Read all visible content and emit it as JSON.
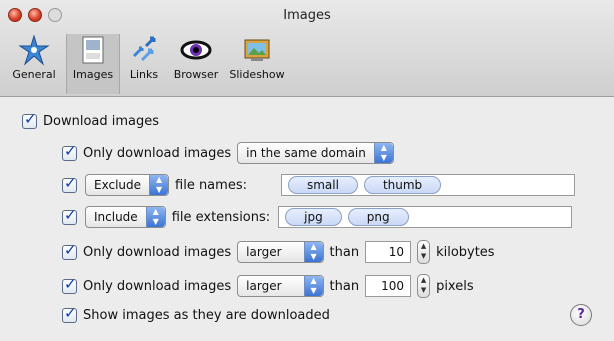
{
  "window": {
    "title": "Images"
  },
  "toolbar": {
    "items": [
      {
        "label": "General",
        "icon": "star-gear-icon"
      },
      {
        "label": "Images",
        "icon": "jpeg-file-icon"
      },
      {
        "label": "Links",
        "icon": "links-arrows-icon"
      },
      {
        "label": "Browser",
        "icon": "eye-icon"
      },
      {
        "label": "Slideshow",
        "icon": "picture-frame-icon"
      }
    ],
    "selected": "Images"
  },
  "settings": {
    "download_images": {
      "checked": true,
      "label": "Download images"
    },
    "only_domain": {
      "checked": true,
      "label": "Only download images",
      "popup": "in the same domain"
    },
    "filenames": {
      "checked": true,
      "popup": "Exclude",
      "label": "file names:",
      "tokens": [
        "small",
        "thumb"
      ]
    },
    "extensions": {
      "checked": true,
      "popup": "Include",
      "label": "file extensions:",
      "tokens": [
        "jpg",
        "png"
      ]
    },
    "size_kb": {
      "checked": true,
      "label": "Only download images",
      "popup": "larger",
      "than": "than",
      "value": "10",
      "unit": "kilobytes"
    },
    "size_px": {
      "checked": true,
      "label": "Only download images",
      "popup": "larger",
      "than": "than",
      "value": "100",
      "unit": "pixels"
    },
    "show_as_downloaded": {
      "checked": true,
      "label": "Show images as they are downloaded"
    }
  },
  "help": {
    "label": "?"
  }
}
